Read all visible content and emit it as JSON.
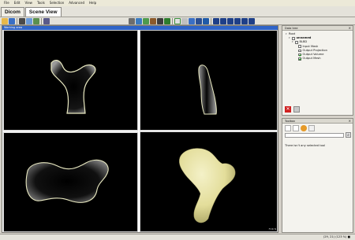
{
  "menu": [
    "File",
    "Edit",
    "View",
    "Tools",
    "Selection",
    "Advanced",
    "Help"
  ],
  "tabs": [
    {
      "label": "Dicom",
      "active": false
    },
    {
      "label": "Scene View",
      "active": true
    }
  ],
  "workspace": {
    "header": "Working area",
    "viewports": [
      {
        "name": "axial-view"
      },
      {
        "name": "sagittal-view",
        "label": "Slice 1"
      },
      {
        "name": "coronal-view"
      },
      {
        "name": "3d-view",
        "label": "FOR N"
      }
    ]
  },
  "data_tree": {
    "title": "Data tree",
    "items": [
      {
        "label": "Root",
        "level": 0,
        "checkbox": false,
        "checked": false
      },
      {
        "label": "unnamed",
        "level": 1,
        "checkbox": true,
        "checked": false
      },
      {
        "label": "BLBD",
        "level": 2,
        "checkbox": true,
        "checked": false
      },
      {
        "label": "Input Mask",
        "level": 3,
        "checkbox": true,
        "checked": false
      },
      {
        "label": "Output Projection",
        "level": 3,
        "checkbox": true,
        "checked": false
      },
      {
        "label": "Output Volume",
        "level": 3,
        "checkbox": true,
        "checked": true
      },
      {
        "label": "Output Mesh",
        "level": 3,
        "checkbox": true,
        "checked": true
      }
    ]
  },
  "toolbox": {
    "title": "Toolbox",
    "message": "There isn't any selected tool"
  },
  "status": {
    "coords": "(29, 21)  (123 %)  ■"
  },
  "colors": {
    "viewport_bg": "#000000",
    "outline": "#e8e8c0",
    "bone_3d": "#e8e4a8",
    "accent": "#2f64c8"
  }
}
